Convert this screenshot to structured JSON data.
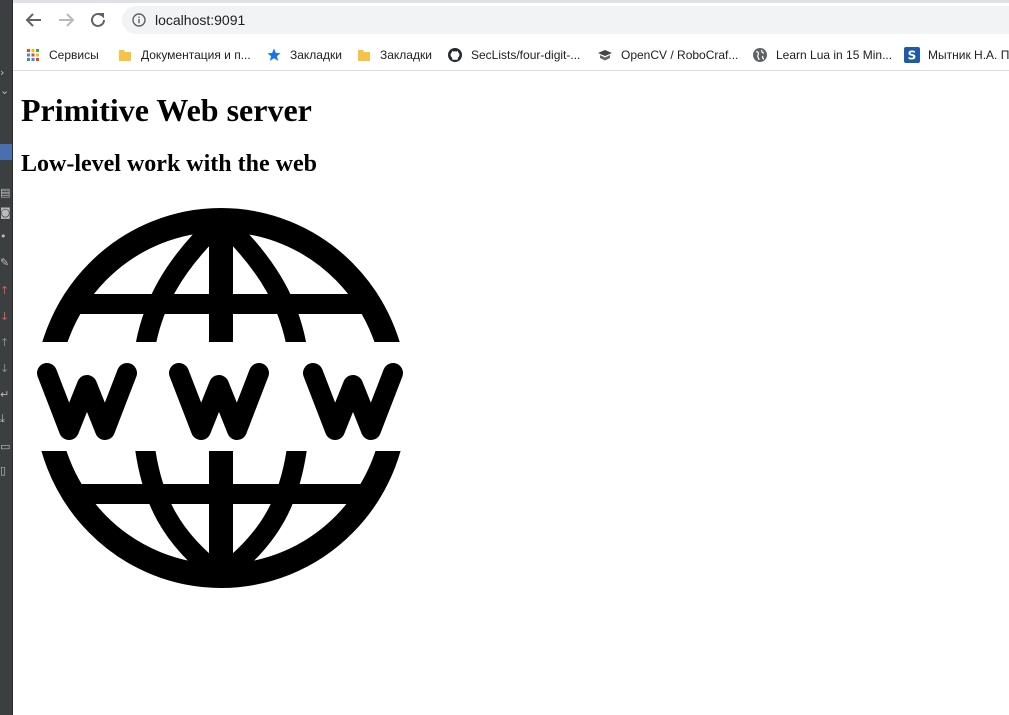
{
  "browser": {
    "url": "localhost:9091",
    "nav": {
      "back": "back-arrow-icon",
      "forward": "forward-arrow-icon",
      "reload": "reload-icon"
    }
  },
  "bookmarks": [
    {
      "label": "Сервисы",
      "icon": "apps-grid-icon"
    },
    {
      "label": "Документация и п...",
      "icon": "folder-icon"
    },
    {
      "label": "Закладки",
      "icon": "star-icon"
    },
    {
      "label": "Закладки",
      "icon": "folder-icon"
    },
    {
      "label": "SecLists/four-digit-...",
      "icon": "github-icon"
    },
    {
      "label": "OpenCV / RoboCraf...",
      "icon": "robocraft-icon"
    },
    {
      "label": "Learn Lua in 15 Min...",
      "icon": "globe-icon"
    },
    {
      "label": "Мытник Н.А. П",
      "icon": "s-logo-icon"
    }
  ],
  "page": {
    "title": "Primitive Web server",
    "subtitle": "Low-level work with the web",
    "image": {
      "label": "WWW"
    }
  },
  "colors": {
    "ide_strip": "#3c3f41",
    "omnibox_bg": "#f1f3f4",
    "folder_yellow": "#f6c344",
    "star_blue": "#1a73e8"
  }
}
